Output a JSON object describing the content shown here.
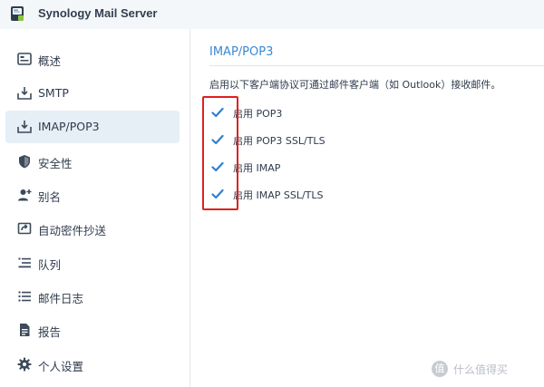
{
  "window": {
    "title": "Synology Mail Server"
  },
  "colors": {
    "accent": "#3a88d4",
    "checkbox": "#2f80d0",
    "highlight": "#e02020",
    "sidebar_active": "#e6eef6"
  },
  "sidebar": {
    "items": [
      {
        "label": "概述",
        "icon": "overview-icon",
        "active": false
      },
      {
        "label": "SMTP",
        "icon": "inbox-download-icon",
        "active": false
      },
      {
        "label": "IMAP/POP3",
        "icon": "inbox-download-icon",
        "active": true
      },
      {
        "label": "安全性",
        "icon": "shield-icon",
        "active": false
      },
      {
        "label": "别名",
        "icon": "user-add-icon",
        "active": false
      },
      {
        "label": "自动密件抄送",
        "icon": "auto-forward-icon",
        "active": false
      },
      {
        "label": "队列",
        "icon": "queue-list-icon",
        "active": false
      },
      {
        "label": "邮件日志",
        "icon": "log-list-icon",
        "active": false
      },
      {
        "label": "报告",
        "icon": "report-icon",
        "active": false
      },
      {
        "label": "个人设置",
        "icon": "gear-icon",
        "active": false
      }
    ]
  },
  "main": {
    "section_title": "IMAP/POP3",
    "description": "启用以下客户端协议可通过邮件客户端（如 Outlook）接收邮件。",
    "options": [
      {
        "label": "启用 POP3",
        "checked": true
      },
      {
        "label": "启用 POP3 SSL/TLS",
        "checked": true
      },
      {
        "label": "启用 IMAP",
        "checked": true
      },
      {
        "label": "启用 IMAP SSL/TLS",
        "checked": true
      }
    ]
  },
  "watermark": {
    "badge": "值",
    "text": "什么值得买"
  }
}
